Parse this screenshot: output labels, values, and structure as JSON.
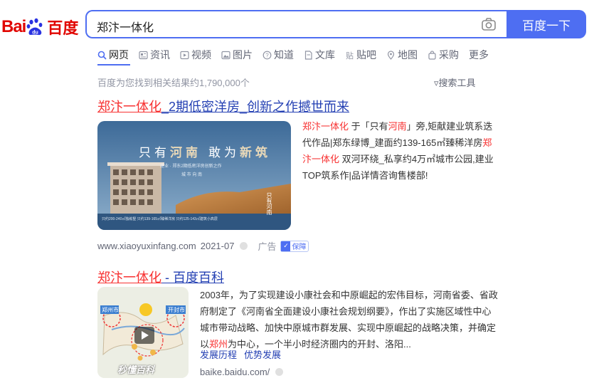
{
  "logo": {
    "latin": "Bai",
    "paw": "du",
    "cn": "百度"
  },
  "search": {
    "query": "郑汴一体化",
    "button_label": "百度一下"
  },
  "tabs": [
    {
      "label": "网页",
      "icon": "search-icon"
    },
    {
      "label": "资讯",
      "icon": "news-icon"
    },
    {
      "label": "视频",
      "icon": "video-icon"
    },
    {
      "label": "图片",
      "icon": "image-icon"
    },
    {
      "label": "知道",
      "icon": "question-icon"
    },
    {
      "label": "文库",
      "icon": "doc-icon"
    },
    {
      "label": "贴吧",
      "icon": "tieba-icon"
    },
    {
      "label": "地图",
      "icon": "map-icon"
    },
    {
      "label": "采购",
      "icon": "cart-icon"
    },
    {
      "label": "更多",
      "icon": ""
    }
  ],
  "result_count": "百度为您找到相关结果约1,790,000个",
  "tools_label": "搜索工具",
  "results": [
    {
      "title_hl": "郑汴一体化",
      "title_rest": "_2期低密洋房_创新之作撼世而来",
      "image_text": {
        "headline_a": "只有",
        "headline_b": "河南",
        "headline_c": "敢为",
        "headline_d": "新筑",
        "sub": "建业 · 郑东2期低密洋房创新之作",
        "sub2": "城 市 向 南",
        "footer": "只约200-240㎡独栋墅   只约139-165㎡臻稀洋房   只约125-143㎡建筑小高层",
        "brand": "只有河南"
      },
      "abstract": [
        {
          "t": "郑汴一体化",
          "hl": true
        },
        {
          "t": " 于「只有",
          "hl": false
        },
        {
          "t": "河南",
          "hl": true
        },
        {
          "t": "」旁,矩献建业筑系迭代作品|郑东绿博_建面约139-165㎡臻稀洋房",
          "hl": false
        },
        {
          "t": "郑汴一体化",
          "hl": true
        },
        {
          "t": " 双河环绕_私享约4万㎡城市公园,建业TOP筑系作|品详情咨询售楼部!",
          "hl": false
        }
      ],
      "url": "www.xiaoyuxinfang.com",
      "date": "2021-07",
      "ad_label": "广告",
      "badge": "保障"
    },
    {
      "title_hl": "郑汴一体化",
      "title_rest": " - 百度百科",
      "image_text": {
        "left_label": "郑州市",
        "right_label": "开封市",
        "watermark": "秒懂百科"
      },
      "abstract": [
        {
          "t": "2003年，为了实现建设小康社会和中原崛起的宏伟目标，河南省委、省政府制定了《河南省全面建设小康社会规划纲要》，作出了实施区域性中心城市带动战略、加快中原城市群发展、实现中原崛起的战略决策，并确定以",
          "hl": false
        },
        {
          "t": "郑州",
          "hl": true
        },
        {
          "t": "为中心，一个半小时经济圈内的开封、洛阳...",
          "hl": false
        }
      ],
      "sublinks": [
        "发展历程",
        "优势发展"
      ],
      "url": "baike.baidu.com/"
    }
  ]
}
